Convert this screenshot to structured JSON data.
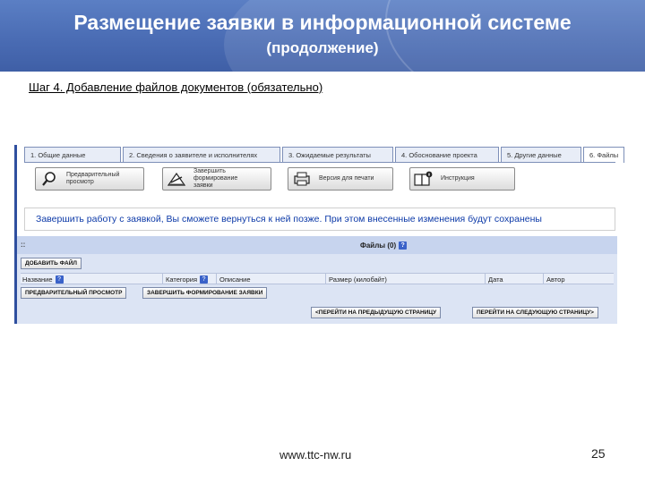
{
  "slide": {
    "title": "Размещение заявки в информационной системе",
    "subtitle": "(продолжение)",
    "step_title": "Шаг 4. Добавление файлов документов (обязательно)",
    "footer_url": "www.ttc-nw.ru",
    "page_number": "25"
  },
  "tabs": [
    {
      "label": "1. Общие данные"
    },
    {
      "label": "2. Сведения о заявителе и исполнителях"
    },
    {
      "label": "3. Ожидаемые результаты"
    },
    {
      "label": "4. Обоснование проекта"
    },
    {
      "label": "5. Другие данные"
    },
    {
      "label": "6. Файлы"
    }
  ],
  "toolbar": {
    "preview_label": "Предварительный просмотр",
    "finish_label": "Завершить формирование заявки",
    "print_label": "Версия для печати",
    "instruction_label": "Инструкция"
  },
  "notice": "Завершить работу с заявкой, Вы сможете вернуться к ней позже. При этом внесенные изменения будут сохранены",
  "files": {
    "grip": "::",
    "title": "Файлы (0)",
    "help": "?",
    "add_button": "ДОБАВИТЬ ФАЙЛ",
    "columns": {
      "name": "Название",
      "category": "Категория",
      "description": "Описание",
      "size": "Размер (килобайт)",
      "date": "Дата",
      "author": "Автор"
    },
    "preview_button": "ПРЕДВАРИТЕЛЬНЫЙ ПРОСМОТР",
    "finish_button": "ЗАВЕРШИТЬ ФОРМИРОВАНИЕ ЗАЯВКИ",
    "prev_page_button": "<ПЕРЕЙТИ НА ПРЕДЫДУЩУЮ СТРАНИЦУ",
    "next_page_button": "ПЕРЕЙТИ НА СЛЕДУЮЩУЮ СТРАНИЦУ>"
  },
  "colors": {
    "header": "#4a6cb4",
    "notice_text": "#0d3aa8",
    "files_bar": "#c7d4ee",
    "panel": "#dce4f4"
  }
}
